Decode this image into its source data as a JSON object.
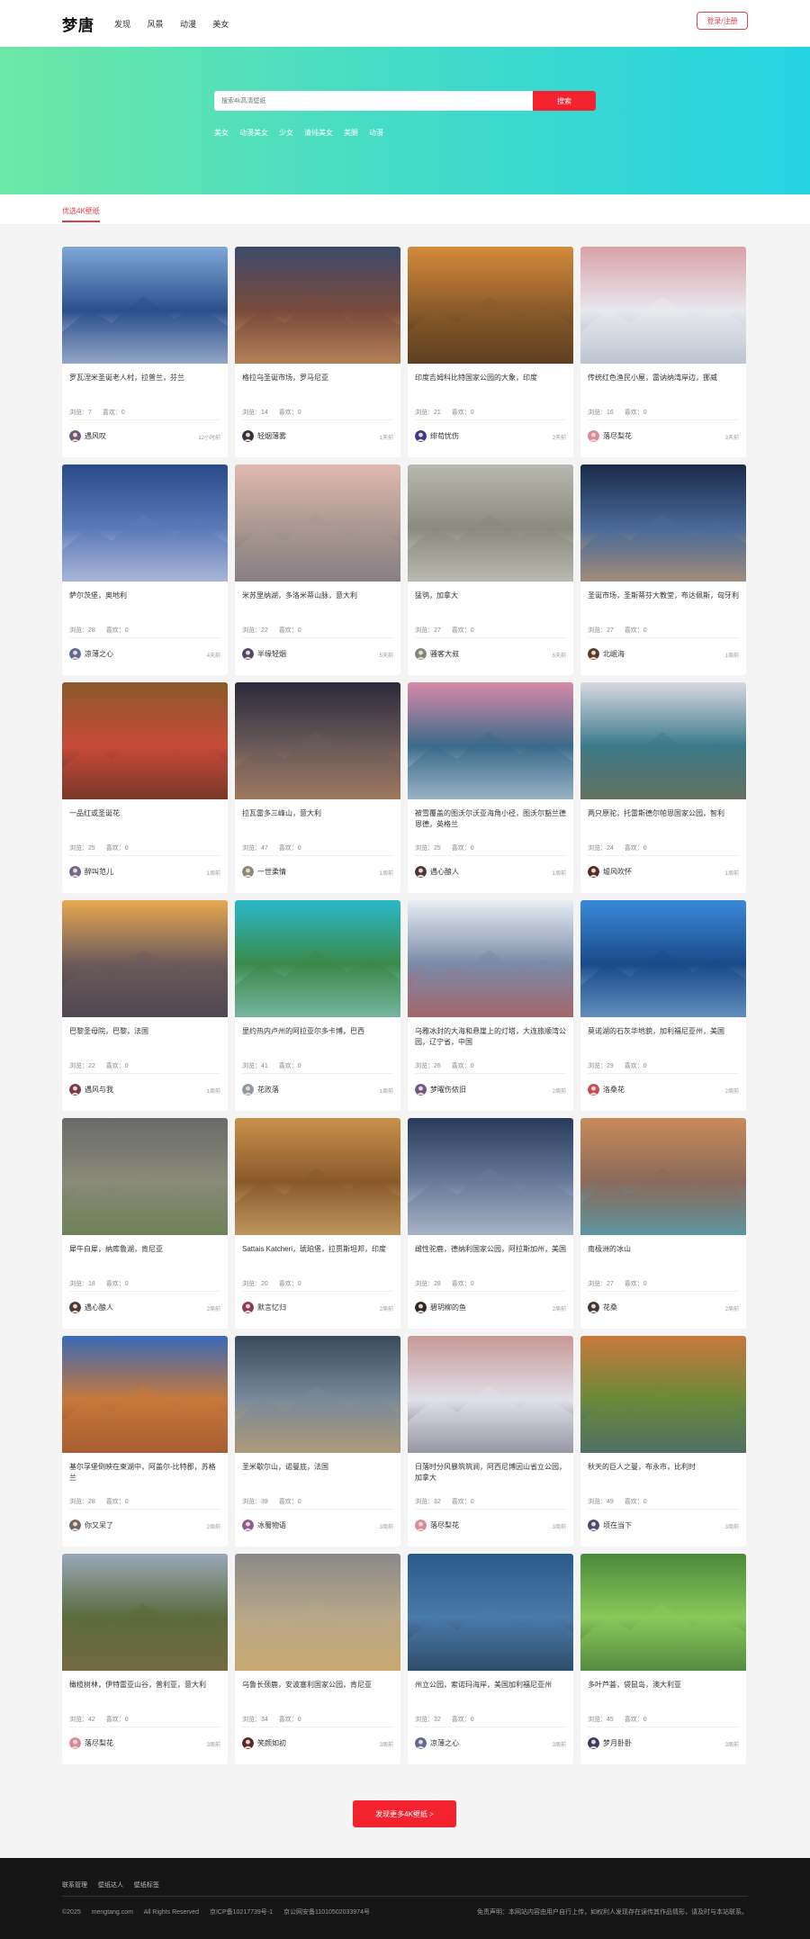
{
  "header": {
    "logo": "梦唐",
    "nav": [
      "发现",
      "风景",
      "动漫",
      "美女"
    ],
    "login": "登录/注册"
  },
  "hero": {
    "search_placeholder": "搜索4k高清壁纸",
    "search_button": "搜索",
    "hot_tags": [
      "美女",
      "动漫美女",
      "少女",
      "清纯美女",
      "美腿",
      "动漫"
    ]
  },
  "section": {
    "tab": "优选4K壁纸"
  },
  "labels": {
    "views": "浏览",
    "likes": "喜欢"
  },
  "cards": [
    {
      "title": "罗瓦涅米圣诞老人村，拉普兰，芬兰",
      "views": 7,
      "likes": 0,
      "author": "遇风叹",
      "time": "12小时前",
      "scene": [
        "#7fa8d8",
        "#2b4f8c",
        "#e9eef6"
      ],
      "avatar": "#6a5a7a"
    },
    {
      "title": "格拉乌圣诞市场，罗马尼亚",
      "views": 14,
      "likes": 0,
      "author": "轻烟薄雾",
      "time": "1天前",
      "scene": [
        "#3c4a6b",
        "#7a4a3a",
        "#e0b070"
      ],
      "avatar": "#333344"
    },
    {
      "title": "印度吉姆科比特国家公园的大象，印度",
      "views": 21,
      "likes": 0,
      "author": "绯苟忧伤",
      "time": "2天前",
      "scene": [
        "#d48a3a",
        "#8a5a2a",
        "#3a2a1a"
      ],
      "avatar": "#3a3a8a"
    },
    {
      "title": "传统红色渔民小屋，雷讷纳湾岸边，挪威",
      "views": 16,
      "likes": 0,
      "author": "落尽梨花",
      "time": "3天前",
      "scene": [
        "#d9a0a8",
        "#e8e8ee",
        "#9aa8b8"
      ],
      "avatar": "#d88a9a"
    },
    {
      "title": "萨尔茨堡，奥地利",
      "views": 28,
      "likes": 0,
      "author": "凉薄之心",
      "time": "4天前",
      "scene": [
        "#2a4a8a",
        "#5a7ab8",
        "#e8e8f0"
      ],
      "avatar": "#5a6a9a"
    },
    {
      "title": "米苏里纳湖，多洛米蒂山脉，意大利",
      "views": 22,
      "likes": 0,
      "author": "半缘轻烟",
      "time": "5天前",
      "scene": [
        "#e0b8b0",
        "#a89890",
        "#6a6a7a"
      ],
      "avatar": "#4a4a6a"
    },
    {
      "title": "猛鸮，加拿大",
      "views": 27,
      "likes": 0,
      "author": "骚客大叔",
      "time": "6天前",
      "scene": [
        "#b8b8b0",
        "#8a8a80",
        "#e0e0d8"
      ],
      "avatar": "#7a8a7a"
    },
    {
      "title": "圣诞市场，圣斯蒂芬大教堂，布达佩斯，匈牙利",
      "views": 27,
      "likes": 0,
      "author": "北岷海",
      "time": "1周前",
      "scene": [
        "#1a2a4a",
        "#4a6a9a",
        "#e8a860"
      ],
      "avatar": "#5a3a2a"
    },
    {
      "title": "一品红或圣诞花",
      "views": 25,
      "likes": 0,
      "author": "醉叫范儿",
      "time": "1周前",
      "scene": [
        "#8a5a2a",
        "#c84a3a",
        "#3a2a1a"
      ],
      "avatar": "#6a6a8a"
    },
    {
      "title": "拉瓦雷多三峰山，意大利",
      "views": 47,
      "likes": 0,
      "author": "一世柔情",
      "time": "1周前",
      "scene": [
        "#2a2a3a",
        "#6a5a5a",
        "#c89060"
      ],
      "avatar": "#8a8a7a"
    },
    {
      "title": "被雪覆盖的图沃尔沃亚海角小径，图沃尔豁兰德恩德，英格兰",
      "views": 25,
      "likes": 0,
      "author": "遇心酿人",
      "time": "1周前",
      "scene": [
        "#d88aa8",
        "#3a6a8a",
        "#e8eef4"
      ],
      "avatar": "#4a3a3a"
    },
    {
      "title": "两只原驼，托雷斯德尔帕恩国家公园，智利",
      "views": 24,
      "likes": 0,
      "author": "墟风吹怀",
      "time": "1周前",
      "scene": [
        "#d8d8e0",
        "#3a7a8a",
        "#8a6a3a"
      ],
      "avatar": "#5a2a2a"
    },
    {
      "title": "巴黎圣母院，巴黎，法国",
      "views": 22,
      "likes": 0,
      "author": "遇风与我",
      "time": "1周前",
      "scene": [
        "#e8a850",
        "#6a5a5a",
        "#3a3a4a"
      ],
      "avatar": "#7a3a4a"
    },
    {
      "title": "里约热内卢州的阿拉亚尔多卡博，巴西",
      "views": 41,
      "likes": 0,
      "author": "花败落",
      "time": "1周前",
      "scene": [
        "#2ab8c8",
        "#3a8a4a",
        "#a8d8e8"
      ],
      "avatar": "#8a9aaa"
    },
    {
      "title": "乌雅冰封的大海和悬崖上的灯塔，大连旅顺湾公园，辽宁省，中国",
      "views": 26,
      "likes": 0,
      "author": "梦曜伤侬旧",
      "time": "2周前",
      "scene": [
        "#e8eef4",
        "#7a8aa8",
        "#c84a3a"
      ],
      "avatar": "#6a5a8a"
    },
    {
      "title": "莫诺湖的石灰华地貌，加利福尼亚州，美国",
      "views": 29,
      "likes": 0,
      "author": "洛桑花",
      "time": "2周前",
      "scene": [
        "#3a8ad8",
        "#1a4a8a",
        "#9ac8e8"
      ],
      "avatar": "#c84a5a"
    },
    {
      "title": "犀牛白犀，纳库鲁湖，肯尼亚",
      "views": 18,
      "likes": 0,
      "author": "遇心酿人",
      "time": "2周前",
      "scene": [
        "#6a6a6a",
        "#8a8a7a",
        "#5a7a3a"
      ],
      "avatar": "#4a3a3a"
    },
    {
      "title": "Sattais Katcheri，琥珀堡，拉贾斯坦邦，印度",
      "views": 20,
      "likes": 0,
      "author": "默言忆归",
      "time": "2周前",
      "scene": [
        "#c8904a",
        "#8a5a2a",
        "#e8c888"
      ],
      "avatar": "#8a3a5a"
    },
    {
      "title": "雌性驼鹿，德纳利国家公园，阿拉斯加州，美国",
      "views": 28,
      "likes": 0,
      "author": "碧玥柳的鱼",
      "time": "2周前",
      "scene": [
        "#2a3a5a",
        "#6a7a9a",
        "#d8e0e8"
      ],
      "avatar": "#2a2a2a"
    },
    {
      "title": "南极洲的冰山",
      "views": 27,
      "likes": 0,
      "author": "花桑",
      "time": "2周前",
      "scene": [
        "#c88a5a",
        "#8a6a5a",
        "#3ab8d8"
      ],
      "avatar": "#3a3a3a"
    },
    {
      "title": "基尔孚堡倒映在柬湖中，阿盖尔-比特郡，苏格兰",
      "views": 28,
      "likes": 0,
      "author": "你又呆了",
      "time": "2周前",
      "scene": [
        "#3a6ab8",
        "#c8783a",
        "#8a4a2a"
      ],
      "avatar": "#6a6a6a"
    },
    {
      "title": "圣米歇尔山，诺曼底，法国",
      "views": 39,
      "likes": 0,
      "author": "冰蜀物语",
      "time": "3周前",
      "scene": [
        "#3a4a5a",
        "#7a8a9a",
        "#d8a860"
      ],
      "avatar": "#8a5a9a"
    },
    {
      "title": "日落时分风暴筑筑涧，阿西尼博因山省立公园，加拿大",
      "views": 32,
      "likes": 0,
      "author": "落尽梨花",
      "time": "3周前",
      "scene": [
        "#c89898",
        "#e0e0e8",
        "#5a5a6a"
      ],
      "avatar": "#d88a9a"
    },
    {
      "title": "秋天的巨人之曼，布永市，比利时",
      "views": 49,
      "likes": 0,
      "author": "顷在当下",
      "time": "3周前",
      "scene": [
        "#c8783a",
        "#6a8a3a",
        "#3a5a8a"
      ],
      "avatar": "#4a4a7a"
    },
    {
      "title": "橄榄树林，伊特雷亚山谷，普利亚，意大利",
      "views": 42,
      "likes": 0,
      "author": "落尽梨花",
      "time": "3周前",
      "scene": [
        "#9aa8b8",
        "#5a6a3a",
        "#8a6a4a"
      ],
      "avatar": "#d88a9a"
    },
    {
      "title": "乌鲁长颈鹿，安波塞利国家公园，肯尼亚",
      "views": 34,
      "likes": 0,
      "author": "笑颜如初",
      "time": "3周前",
      "scene": [
        "#8a8a8a",
        "#b8a888",
        "#d8a860"
      ],
      "avatar": "#5a2a2a"
    },
    {
      "title": "州立公园，索诺玛海岸，美国加利福尼亚州",
      "views": 32,
      "likes": 0,
      "author": "凉薄之心",
      "time": "3周前",
      "scene": [
        "#2a5a8a",
        "#4a7aa8",
        "#1a2a3a"
      ],
      "avatar": "#5a6a9a"
    },
    {
      "title": "多叶芦荟，袋鼠岛，澳大利亚",
      "views": 45,
      "likes": 0,
      "author": "梦月卧卧",
      "time": "3周前",
      "scene": [
        "#4a8a3a",
        "#8ac85a",
        "#2a5a2a"
      ],
      "avatar": "#3a3a6a"
    }
  ],
  "more_button": "发现更多4K壁纸 >",
  "footer": {
    "links": [
      "联系管理",
      "壁纸达人",
      "壁纸标签"
    ],
    "copyright": "©2025",
    "domain": "mengtang.com",
    "rights": "All Rights Reserved",
    "icp": "京ICP备10217739号-1",
    "police": "京公网安备11010502033974号",
    "disclaimer": "免责声明：本网站内容由用户自行上传，如权利人发现存在误传其作品情形，请及时与本站联系。"
  }
}
